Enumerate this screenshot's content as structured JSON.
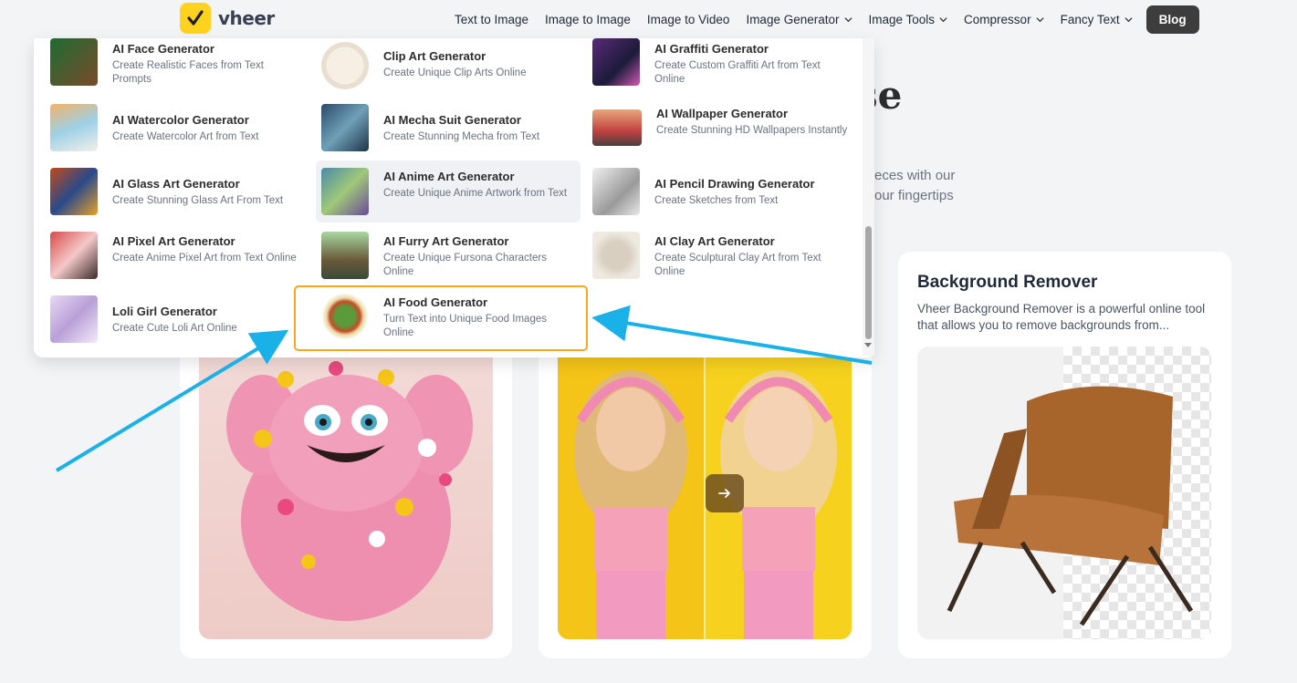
{
  "brand": {
    "name": "vheer",
    "accent": "#ffd21f"
  },
  "nav": {
    "items": [
      {
        "label": "Text to Image",
        "dropdown": false
      },
      {
        "label": "Image to Image",
        "dropdown": false
      },
      {
        "label": "Image to Video",
        "dropdown": false
      },
      {
        "label": "Image Generator",
        "dropdown": true
      },
      {
        "label": "Image Tools",
        "dropdown": true
      },
      {
        "label": "Compressor",
        "dropdown": true
      },
      {
        "label": "Fancy Text",
        "dropdown": true
      }
    ],
    "blog_label": "Blog"
  },
  "hero": {
    "title_fragment": "se",
    "subtitle_line1": "eces with our",
    "subtitle_line2": "our fingertips"
  },
  "dropdown": {
    "items": [
      {
        "title": "AI Face Generator",
        "desc": "Create Realistic Faces from Text Prompts"
      },
      {
        "title": "Clip Art Generator",
        "desc": "Create Unique Clip Arts Online"
      },
      {
        "title": "AI Graffiti Generator",
        "desc": "Create Custom Graffiti Art from Text Online"
      },
      {
        "title": "AI Watercolor Generator",
        "desc": "Create Watercolor Art from Text"
      },
      {
        "title": "AI Mecha Suit Generator",
        "desc": "Create Stunning Mecha from Text"
      },
      {
        "title": "AI Wallpaper Generator",
        "desc": "Create Stunning HD Wallpapers Instantly"
      },
      {
        "title": "AI Glass Art Generator",
        "desc": "Create Stunning Glass Art From Text"
      },
      {
        "title": "AI Anime Art Generator",
        "desc": "Create Unique Anime Artwork from Text"
      },
      {
        "title": "AI Pencil Drawing Generator",
        "desc": "Create Sketches from Text"
      },
      {
        "title": "AI Pixel Art Generator",
        "desc": "Create Anime Pixel Art from Text Online"
      },
      {
        "title": "AI Furry Art Generator",
        "desc": "Create Unique Fursona Characters Online"
      },
      {
        "title": "AI Clay Art Generator",
        "desc": "Create Sculptural Clay Art from Text Online"
      },
      {
        "title": "Loli Girl Generator",
        "desc": "Create Cute Loli Art Online"
      },
      {
        "title": "AI Food Generator",
        "desc": "Turn Text into Unique Food Images Online"
      }
    ]
  },
  "cards": {
    "background_remover": {
      "title": "Background Remover",
      "desc": "Vheer Background Remover is a powerful online tool that allows you to remove backgrounds from..."
    }
  },
  "annotation_color": "#1ab0e8",
  "highlight_color": "#f5a623"
}
